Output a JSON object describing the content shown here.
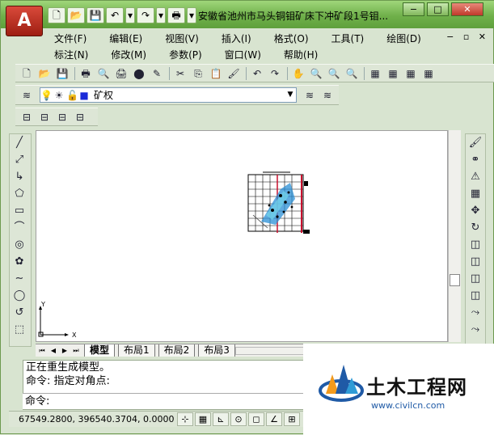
{
  "window": {
    "title": "安徽省池州市马头铜钼矿床下冲矿段1号钼...",
    "app_button_label": "A",
    "controls": {
      "minimize": "−",
      "maximize": "□",
      "close": "✕"
    },
    "mdi_controls": "− ▫ ✕"
  },
  "quick_access": [
    "🗋",
    "📂",
    "💾",
    "↶",
    "▾",
    "↷",
    "▾",
    "🖶",
    "▾"
  ],
  "menu": {
    "row1": [
      "文件(F)",
      "编辑(E)",
      "视图(V)",
      "插入(I)",
      "格式(O)",
      "工具(T)",
      "绘图(D)"
    ],
    "row2": [
      "标注(N)",
      "修改(M)",
      "参数(P)",
      "窗口(W)",
      "帮助(H)"
    ]
  },
  "toolbar_standard": [
    "🗋",
    "📂",
    "💾",
    "🖶",
    "🔍",
    "🖨",
    "⬤",
    "✎",
    "✂",
    "⎘",
    "📋",
    "🖌",
    "↶",
    "↷",
    "✋",
    "🔍",
    "🔍",
    "🔍",
    "▦",
    "▦",
    "▦",
    "▦"
  ],
  "layer": {
    "current": "矿权",
    "state_icons": [
      "💡",
      "☀",
      "🔓",
      "■"
    ],
    "right_icons": [
      "≋",
      "≋",
      "≋"
    ]
  },
  "toolbar_small": [
    "⊟",
    "⊟",
    "⊟",
    "⊟"
  ],
  "left_tools": [
    "╱",
    "⤢",
    "↳",
    "⬠",
    "▭",
    "⌒",
    "◎",
    "✿",
    "∼",
    "◯",
    "↺",
    "⬚",
    "⬚",
    "⬚",
    "⬚"
  ],
  "right_tools": [
    "🖌",
    "⚭",
    "⚠",
    "▦",
    "✥",
    "↻",
    "◫",
    "◫",
    "◫",
    "◫",
    "⤳",
    "⤳",
    "◱",
    "◳"
  ],
  "ucs": {
    "y": "Y",
    "x": "X"
  },
  "layout_tabs": [
    "模型",
    "布局1",
    "布局2",
    "布局3"
  ],
  "command": {
    "lines": [
      "正在重生成模型。",
      "命令: 指定对角点:"
    ],
    "prompt": "命令:"
  },
  "status": {
    "coords": "67549.2800, 396540.3704, 0.0000",
    "icons": [
      "⊹",
      "▦",
      "⊾",
      "⊙",
      "◻",
      "∠",
      "⊞"
    ]
  },
  "watermark": {
    "title": "土木工程网",
    "url": "www.civilcn.com"
  },
  "colors": {
    "title_bar": "#6fb04a",
    "app_button": "#c0392b",
    "drawing_blue": "#2a8fd6",
    "drawing_red": "#c8102e"
  }
}
